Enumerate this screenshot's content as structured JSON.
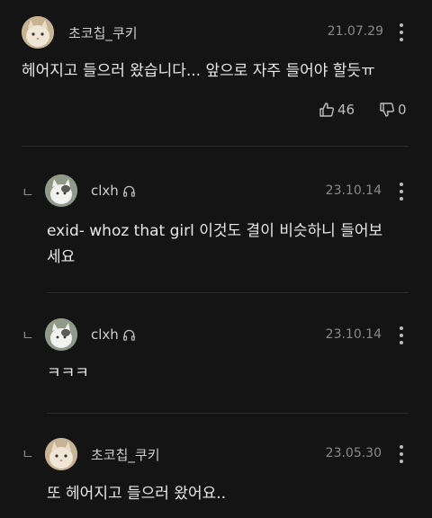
{
  "comments": [
    {
      "username": "초코칩_쿠키",
      "date": "21.07.29",
      "text": "헤어지고 들으러 왔습니다... 앞으로 자주 들어야 할듯ㅠ",
      "likes": "46",
      "dislikes": "0",
      "is_reply": false,
      "avatar": "cat-avatar"
    },
    {
      "username": "clxh",
      "date": "23.10.14",
      "text_lines": [
        "exid- whoz that girl 이것도 결이 비슷하니 들어보",
        "세요"
      ],
      "is_reply": true,
      "badge": "headphones-icon",
      "avatar": "cat-avatar"
    },
    {
      "username": "clxh",
      "date": "23.10.14",
      "text": "ㅋㅋㅋ",
      "is_reply": true,
      "badge": "headphones-icon",
      "avatar": "cat-avatar"
    },
    {
      "username": "초코칩_쿠키",
      "date": "23.05.30",
      "text": "또 헤어지고 들으러 왔어요..",
      "is_reply": true,
      "avatar": "cat-avatar"
    }
  ],
  "reply_marker": "ㄴ",
  "colors": {
    "background": "#141414",
    "text": "#e8e8e8",
    "muted": "#8a8a8a",
    "divider": "#2c2c2c"
  }
}
